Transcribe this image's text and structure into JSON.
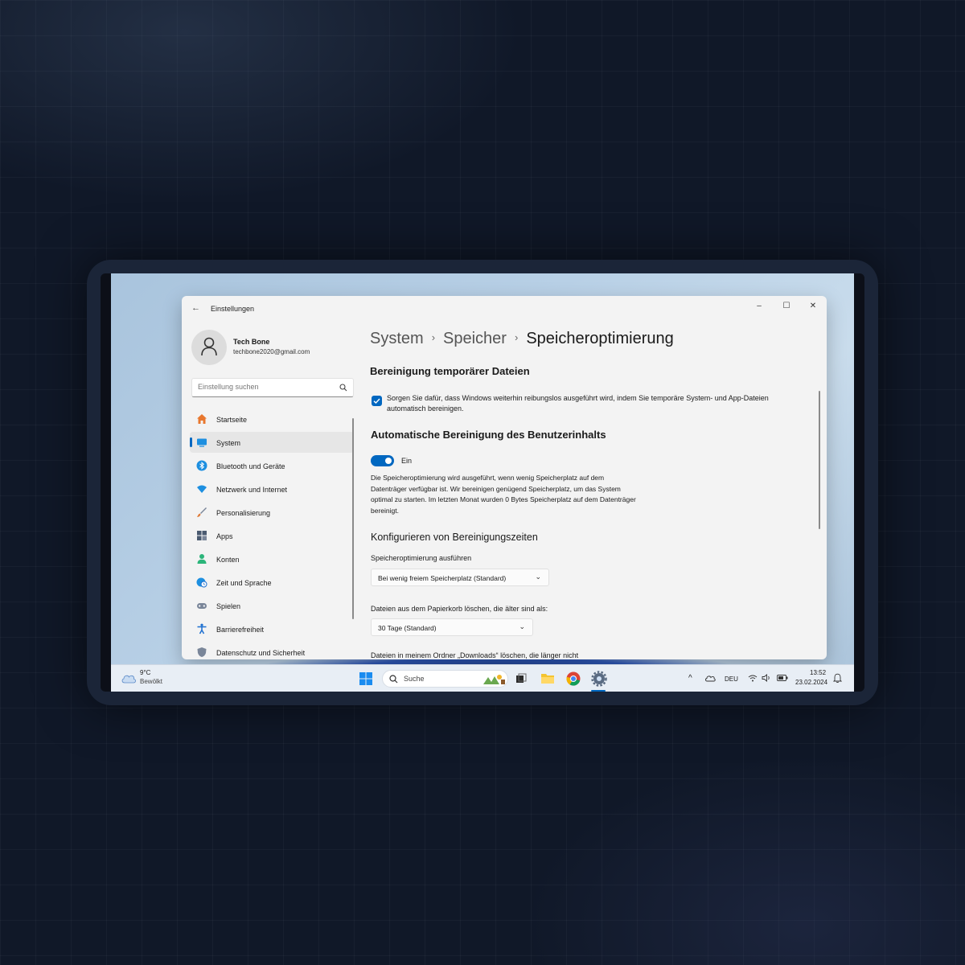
{
  "window": {
    "title": "Einstellungen",
    "back_glyph": "←",
    "minimize_glyph": "–",
    "maximize_glyph": "☐",
    "close_glyph": "✕"
  },
  "user": {
    "name": "Tech Bone",
    "email": "techbone2020@gmail.com"
  },
  "search": {
    "placeholder": "Einstellung suchen"
  },
  "sidebar": {
    "items": [
      {
        "label": "Startseite",
        "icon": "home-icon",
        "color": "#e8772e"
      },
      {
        "label": "System",
        "icon": "monitor-icon",
        "color": "#1d8fe0",
        "active": true
      },
      {
        "label": "Bluetooth und Geräte",
        "icon": "bluetooth-icon",
        "color": "#1d8fe0"
      },
      {
        "label": "Netzwerk und Internet",
        "icon": "wifi-icon",
        "color": "#1d8fe0"
      },
      {
        "label": "Personalisierung",
        "icon": "brush-icon",
        "color": "#e07b39"
      },
      {
        "label": "Apps",
        "icon": "apps-icon",
        "color": "#4a5a70"
      },
      {
        "label": "Konten",
        "icon": "person-icon",
        "color": "#2bb57a"
      },
      {
        "label": "Zeit und Sprache",
        "icon": "globe-clock-icon",
        "color": "#1d8fe0"
      },
      {
        "label": "Spielen",
        "icon": "gamepad-icon",
        "color": "#7a8699"
      },
      {
        "label": "Barrierefreiheit",
        "icon": "accessibility-icon",
        "color": "#1d6fd0"
      },
      {
        "label": "Datenschutz und Sicherheit",
        "icon": "shield-icon",
        "color": "#7a8699"
      }
    ]
  },
  "breadcrumb": {
    "items": [
      "System",
      "Speicher",
      "Speicheroptimierung"
    ],
    "separator": "›"
  },
  "section_temp": {
    "heading": "Bereinigung temporärer Dateien",
    "checkbox_text": "Sorgen Sie dafür, dass Windows weiterhin reibungslos ausgeführt wird, indem Sie temporäre System- und App-Dateien automatisch bereinigen.",
    "checked": true
  },
  "section_auto": {
    "heading": "Automatische Bereinigung des Benutzerinhalts",
    "toggle_label": "Ein",
    "toggle_on": true,
    "description": "Die Speicheroptimierung wird ausgeführt, wenn wenig Speicherplatz auf dem Datenträger verfügbar ist. Wir bereinigen genügend Speicherplatz, um das System optimal zu starten. Im letzten Monat wurden 0 Bytes Speicherplatz auf dem Datenträger bereinigt."
  },
  "section_config": {
    "heading": "Konfigurieren von Bereinigungszeiten",
    "run_label": "Speicheroptimierung ausführen",
    "run_value": "Bei wenig freiem Speicherplatz (Standard)",
    "recycle_label": "Dateien aus dem Papierkorb löschen, die älter sind als:",
    "recycle_value": "30 Tage (Standard)",
    "downloads_label": "Dateien in meinem Ordner „Downloads“ löschen, die länger nicht"
  },
  "taskbar": {
    "weather_temp": "9°C",
    "weather_desc": "Bewölkt",
    "search_label": "Suche",
    "language": "DEU",
    "time": "13:52",
    "date": "23.02.2024",
    "chevron_glyph": "^"
  },
  "colors": {
    "accent": "#0067c0",
    "window_bg": "#f3f3f3"
  }
}
